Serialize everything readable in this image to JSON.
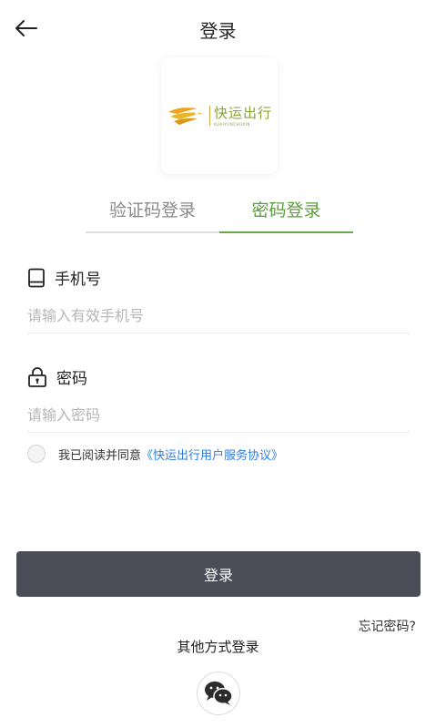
{
  "header": {
    "title": "登录",
    "back_icon": "arrow-left-icon"
  },
  "logo": {
    "cn": "快运出行",
    "en": "KUAIYUNCHUXIN"
  },
  "tabs": [
    {
      "label": "验证码登录",
      "active": false
    },
    {
      "label": "密码登录",
      "active": true
    }
  ],
  "colors": {
    "accent": "#6aa84f",
    "button": "#4a4c58",
    "link": "#2f7de1"
  },
  "form": {
    "phone": {
      "label": "手机号",
      "placeholder": "请输入有效手机号",
      "value": "",
      "icon": "phone-icon"
    },
    "password": {
      "label": "密码",
      "placeholder": "请输入密码",
      "value": "",
      "icon": "lock-icon"
    }
  },
  "agreement": {
    "text": "我已阅读并同意",
    "link": "《快运出行用户服务协议》",
    "checked": false
  },
  "login_button": "登录",
  "forgot_password": "忘记密码?",
  "other_login": {
    "label": "其他方式登录",
    "icons": [
      "wechat-icon"
    ]
  }
}
